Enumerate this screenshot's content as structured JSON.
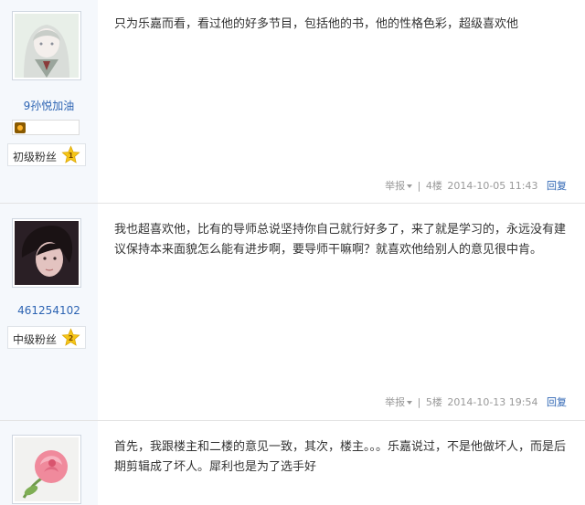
{
  "posts": [
    {
      "username": "9孙悦加油",
      "fan_level": "初级粉丝",
      "level_number": "1",
      "content": "只为乐嘉而看，看过他的好多节目，包括他的书，他的性格色彩，超级喜欢他",
      "report_label": "举报",
      "separator": "|",
      "floor": "4楼",
      "timestamp": "2014-10-05 11:43",
      "reply_label": "回复"
    },
    {
      "username": "461254102",
      "fan_level": "中级粉丝",
      "level_number": "2",
      "content": "我也超喜欢他，比有的导师总说坚持你自己就行好多了，来了就是学习的，永远没有建议保持本来面貌怎么能有进步啊，要导师干嘛啊？就喜欢他给别人的意见很中肯。",
      "report_label": "举报",
      "separator": "|",
      "floor": "5楼",
      "timestamp": "2014-10-13 19:54",
      "reply_label": "回复"
    },
    {
      "content": "首先，我跟楼主和二楼的意见一致，其次，楼主。。。乐嘉说过，不是他做坏人，而是后期剪辑成了坏人。犀利也是为了选手好"
    }
  ],
  "colors": {
    "link": "#2d64b3",
    "sidebar_bg": "#f5f8fc",
    "star": "#f5c518"
  },
  "icons": [
    "anime-avatar",
    "portrait-avatar",
    "rose-avatar",
    "medal-badge-icon",
    "level-star-icon",
    "dropdown-caret-icon"
  ]
}
